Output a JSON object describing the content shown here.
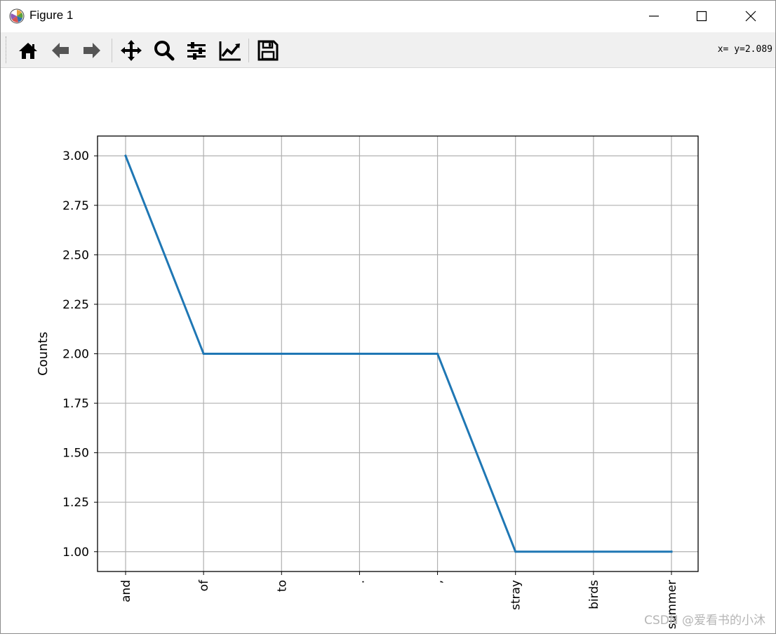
{
  "window": {
    "title": "Figure 1",
    "coords_text": "x=  y=2.089",
    "watermark": "CSDN @爱看书的小沐"
  },
  "toolbar": {
    "icons": [
      "home-icon",
      "back-icon",
      "forward-icon",
      "pan-icon",
      "zoom-icon",
      "subplots-icon",
      "edit-axes-icon",
      "save-icon"
    ]
  },
  "colors": {
    "line": "#1f77b4",
    "grid": "#b0b0b0",
    "toolbar_bg": "#f0f0f0"
  },
  "chart_data": {
    "type": "line",
    "categories": [
      "and",
      "of",
      "to",
      ".",
      ",",
      "stray",
      "birds",
      "summer"
    ],
    "values": [
      3,
      2,
      2,
      2,
      2,
      1,
      1,
      1
    ],
    "title": "",
    "xlabel": "",
    "ylabel": "Counts",
    "ylim": [
      0.9,
      3.1
    ],
    "yticks": [
      "1.00",
      "1.25",
      "1.50",
      "1.75",
      "2.00",
      "2.25",
      "2.50",
      "2.75",
      "3.00"
    ],
    "grid": true
  }
}
